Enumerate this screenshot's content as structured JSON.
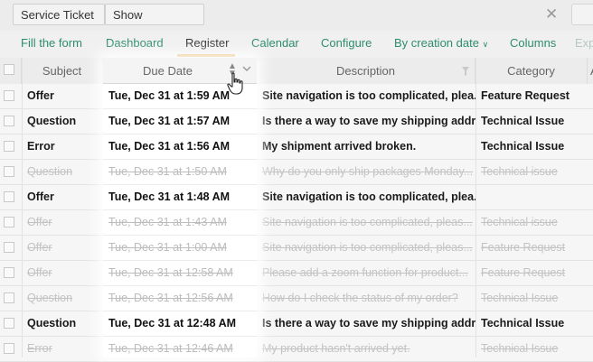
{
  "filter_bar": {
    "chips": [
      {
        "label": "Service Ticket"
      },
      {
        "label": "Show finished",
        "removable": true
      }
    ],
    "clear_icon": "close-icon"
  },
  "menu": {
    "items": [
      "Fill the form",
      "Dashboard",
      "Register",
      "Calendar",
      "Configure",
      "By creation date",
      "Columns",
      "Exp"
    ],
    "active": "Register"
  },
  "columns": {
    "subject": "Subject",
    "due_date": "Due Date",
    "description": "Description",
    "category": "Category",
    "extra": "A"
  },
  "rows": [
    {
      "subject": "Offer",
      "due": "Tue, Dec 31 at 1:59 AM",
      "description": "Site navigation is too complicated, plea...",
      "category": "Feature Request",
      "extra": "",
      "finished": false
    },
    {
      "subject": "Question",
      "due": "Tue, Dec 31 at 1:57 AM",
      "description": "Is there a way to save my shipping addr...",
      "category": "Technical Issue",
      "extra": "",
      "finished": false
    },
    {
      "subject": "Error",
      "due": "Tue, Dec 31 at 1:56 AM",
      "description": "My shipment arrived broken.",
      "category": "Technical Issue",
      "extra": "",
      "finished": false
    },
    {
      "subject": "Question",
      "due": "Tue, Dec 31 at 1:50 AM",
      "description": "Why do you only ship packages Monday...",
      "category": "Technical issue",
      "extra": "",
      "finished": true
    },
    {
      "subject": "Offer",
      "due": "Tue, Dec 31 at 1:48 AM",
      "description": "Site navigation is too complicated, plea...",
      "category": "",
      "extra": "",
      "finished": false
    },
    {
      "subject": "Offer",
      "due": "Tue, Dec 31 at 1:43 AM",
      "description": "Site navigation is too complicated, pleas...",
      "category": "Technical issue",
      "extra": "",
      "finished": true
    },
    {
      "subject": "Offer",
      "due": "Tue, Dec 31 at 1:00 AM",
      "description": "Site navigation is too complicated, pleas...",
      "category": "Feature Request",
      "extra": "",
      "finished": true
    },
    {
      "subject": "Offer",
      "due": "Tue, Dec 31 at 12:58 AM",
      "description": "Please add a zoom function for product...",
      "category": "Feature Request",
      "extra": "",
      "finished": true
    },
    {
      "subject": "Question",
      "due": "Tue, Dec 31 at 12:56 AM",
      "description": "How do I check the status of my order?",
      "category": "Technical Issue",
      "extra": "",
      "finished": true
    },
    {
      "subject": "Question",
      "due": "Tue, Dec 31 at 12:48 AM",
      "description": "Is there a way to save my shipping addr...",
      "category": "Technical Issue",
      "extra": "",
      "finished": false
    },
    {
      "subject": "Error",
      "due": "Tue, Dec 31 at 12:46 AM",
      "description": "My product hasn't arrived yet.",
      "category": "Technical Issue",
      "extra": "",
      "finished": true
    }
  ]
}
